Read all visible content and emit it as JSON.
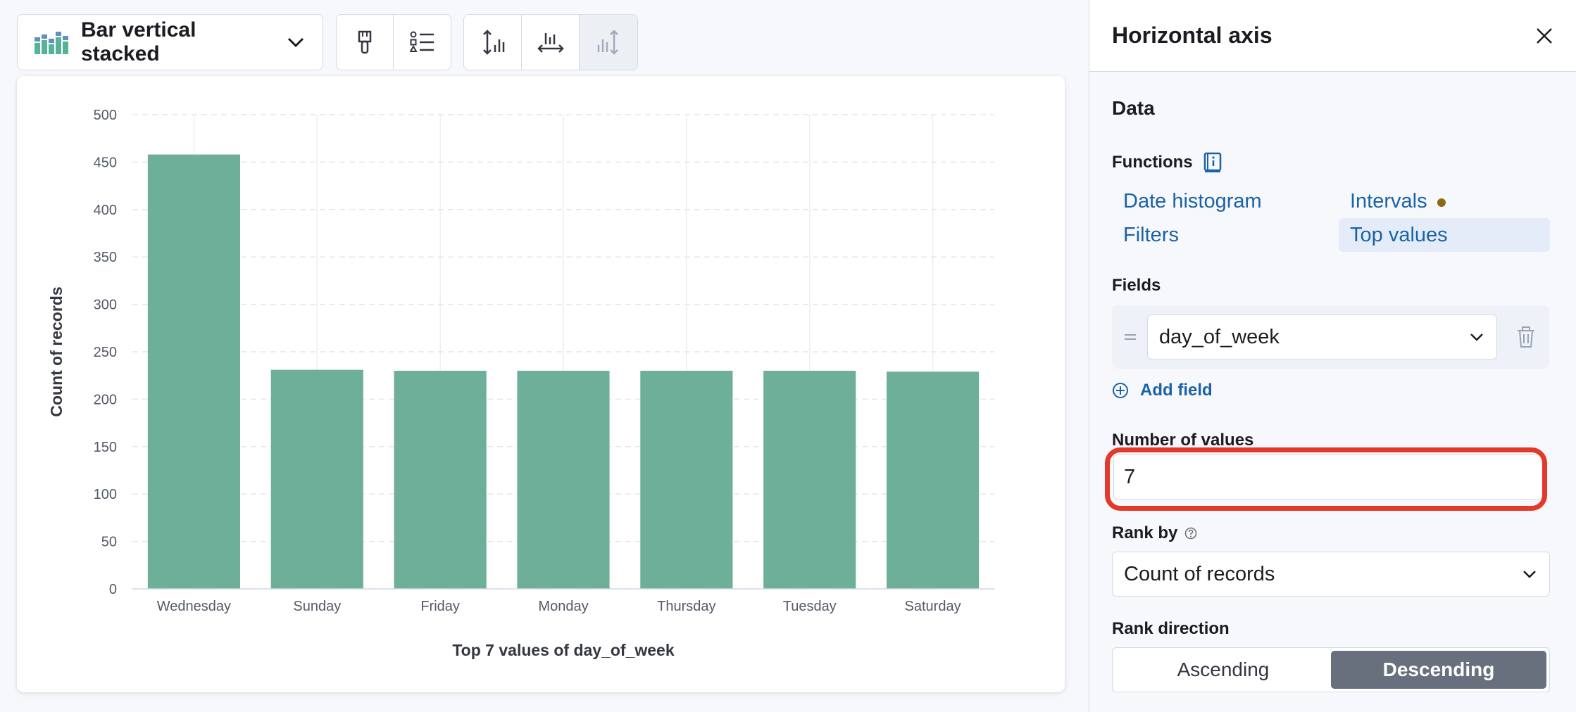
{
  "toolbar": {
    "chart_type_label": "Bar vertical stacked",
    "icons": [
      "bar-chart-icon",
      "chevron-down-icon",
      "paintbrush-icon",
      "legend-list-icon",
      "left-axis-icon",
      "bottom-axis-icon",
      "right-axis-icon"
    ]
  },
  "chart_data": {
    "type": "bar",
    "categories": [
      "Wednesday",
      "Sunday",
      "Friday",
      "Monday",
      "Thursday",
      "Tuesday",
      "Saturday"
    ],
    "values": [
      458,
      231,
      230,
      230,
      230,
      230,
      229
    ],
    "ylabel": "Count of records",
    "xlabel": "Top 7 values of day_of_week",
    "ylim": [
      0,
      500
    ],
    "yticks": [
      0,
      50,
      100,
      150,
      200,
      250,
      300,
      350,
      400,
      450,
      500
    ],
    "color": "#6daf99",
    "grid": true
  },
  "side": {
    "title": "Horizontal axis",
    "section": "Data",
    "functions_label": "Functions",
    "functions": [
      "Date histogram",
      "Intervals",
      "Filters",
      "Top values"
    ],
    "selected_function": "Top values",
    "fields_label": "Fields",
    "field_value": "day_of_week",
    "add_field_label": "Add field",
    "num_values_label": "Number of values",
    "num_values": "7",
    "rank_by_label": "Rank by",
    "rank_by_value": "Count of records",
    "rank_direction_label": "Rank direction",
    "rank_options": [
      "Ascending",
      "Descending"
    ],
    "rank_direction_selected": "Descending"
  },
  "colors": {
    "accent": "#1a63a8",
    "highlight": "#e3392a",
    "bar": "#6daf99"
  }
}
